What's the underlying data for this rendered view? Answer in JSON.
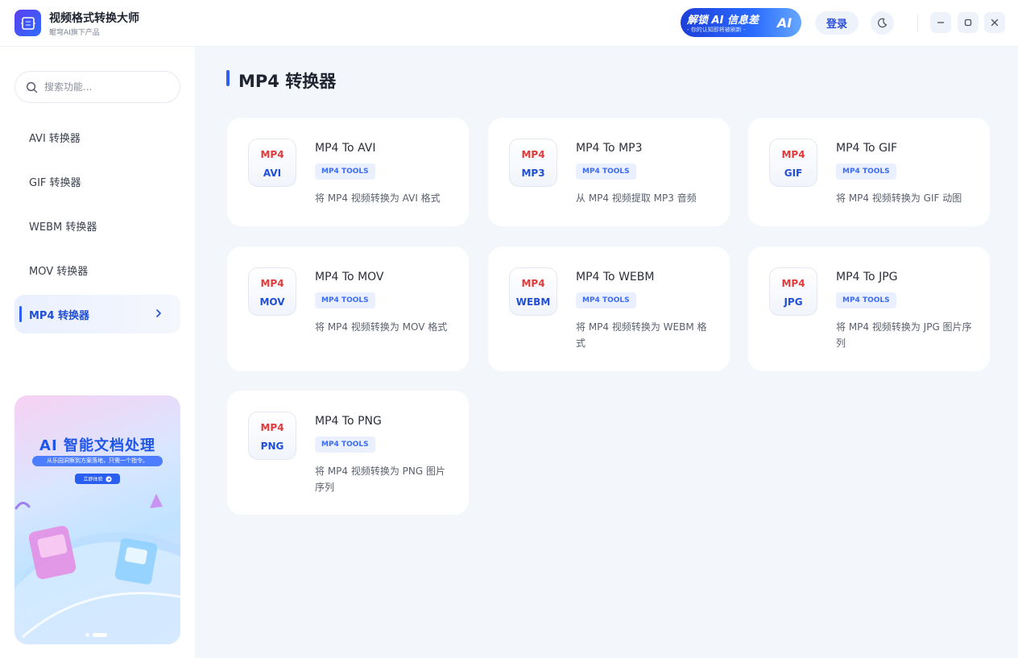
{
  "app": {
    "title": "视频格式转换大师",
    "subtitle": "鲲穹AI旗下产品"
  },
  "titlebar": {
    "banner_title": "解锁 AI 信息差",
    "banner_sub": "- 你的认知即将被刷新 -",
    "banner_ai": "AI",
    "login_label": "登录"
  },
  "sidebar": {
    "search_placeholder": "搜索功能...",
    "items": [
      {
        "label": "AVI 转换器"
      },
      {
        "label": "GIF 转换器"
      },
      {
        "label": "WEBM 转换器"
      },
      {
        "label": "MOV 转换器"
      },
      {
        "label": "MP4 转换器",
        "active": true
      }
    ],
    "promo": {
      "title": "AI 智能文档处理",
      "subtitle": "从乐园洞察到方案落地，只需一个指令。",
      "button": "立即体验"
    }
  },
  "main": {
    "title": "MP4 转换器",
    "cards": [
      {
        "icon_top": "MP4",
        "icon_bottom": "AVI",
        "title": "MP4 To AVI",
        "tag": "MP4 TOOLS",
        "desc": "将 MP4 视频转换为 AVI 格式"
      },
      {
        "icon_top": "MP4",
        "icon_bottom": "MP3",
        "title": "MP4 To MP3",
        "tag": "MP4 TOOLS",
        "desc": "从 MP4 视频提取 MP3 音频"
      },
      {
        "icon_top": "MP4",
        "icon_bottom": "GIF",
        "title": "MP4 To GIF",
        "tag": "MP4 TOOLS",
        "desc": "将 MP4 视频转换为 GIF 动图"
      },
      {
        "icon_top": "MP4",
        "icon_bottom": "MOV",
        "title": "MP4 To MOV",
        "tag": "MP4 TOOLS",
        "desc": "将 MP4 视频转换为 MOV 格式"
      },
      {
        "icon_top": "MP4",
        "icon_bottom": "WEBM",
        "title": "MP4 To WEBM",
        "tag": "MP4 TOOLS",
        "desc": "将 MP4 视频转换为 WEBM 格式"
      },
      {
        "icon_top": "MP4",
        "icon_bottom": "JPG",
        "title": "MP4 To JPG",
        "tag": "MP4 TOOLS",
        "desc": "将 MP4 视频转换为 JPG 图片序列"
      },
      {
        "icon_top": "MP4",
        "icon_bottom": "PNG",
        "title": "MP4 To PNG",
        "tag": "MP4 TOOLS",
        "desc": "将 MP4 视频转换为 PNG 图片序列"
      }
    ]
  },
  "colors": {
    "accent": "#2f5ff0",
    "format_red": "#e03a3a",
    "format_blue": "#1f4fd6",
    "background": "#f3f6fb"
  },
  "icons": {
    "logo": "app-logo-icon",
    "search": "search-icon",
    "theme": "moon-icon",
    "minimize": "minimize-icon",
    "maximize": "maximize-icon",
    "close": "close-icon",
    "chevron": "chevron-right-icon"
  }
}
